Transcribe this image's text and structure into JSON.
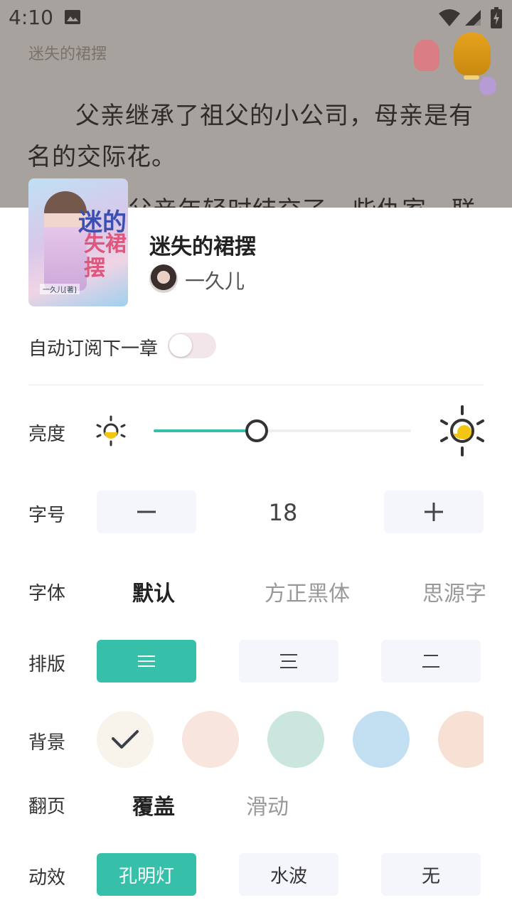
{
  "status_bar": {
    "time": "4:10"
  },
  "reader": {
    "book_title": "迷失的裙摆",
    "paragraph": "父亲继承了祖父的小公司，母亲是有名的交际花。",
    "cut_line": "父亲年轻时结交了一些仇家，联"
  },
  "book": {
    "title": "迷失的裙摆",
    "author": "一久儿",
    "cover_title_line1": "迷的",
    "cover_title_line2": "失裙",
    "cover_title_line3": "摆",
    "cover_author": "一久儿[著]"
  },
  "settings": {
    "auto_subscribe": {
      "label": "自动订阅下一章",
      "on": false
    },
    "brightness": {
      "label": "亮度",
      "level_percent": 40
    },
    "font_size": {
      "label": "字号",
      "value": "18"
    },
    "font": {
      "label": "字体",
      "options": [
        "默认",
        "方正黑体",
        "思源字"
      ],
      "selected": 0
    },
    "layout": {
      "label": "排版",
      "options": [
        "compact-lines-icon",
        "medium-lines-icon",
        "loose-lines-icon"
      ],
      "selected": 0
    },
    "background": {
      "label": "背景",
      "swatches": [
        "#f8f4ec",
        "#f7e5de",
        "#cbe5df",
        "#c3e0f3",
        "#f6e1d4"
      ],
      "selected": 0
    },
    "page_turn": {
      "label": "翻页",
      "options": [
        "覆盖",
        "滑动"
      ],
      "selected": 0
    },
    "animation": {
      "label": "动效",
      "options": [
        "孔明灯",
        "水波",
        "无"
      ],
      "selected": 0
    }
  },
  "colors": {
    "accent": "#36bfa9",
    "button_bg": "#f5f6fc",
    "dim_overlay": "#a8a29e"
  }
}
